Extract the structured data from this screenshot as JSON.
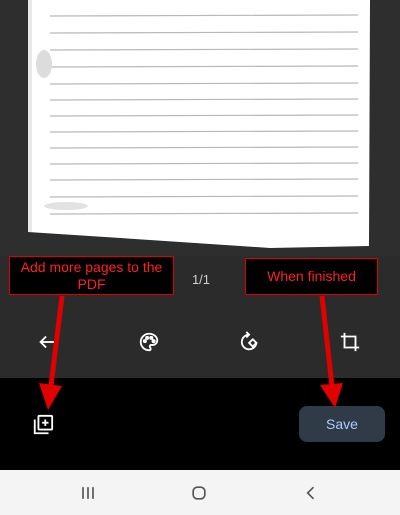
{
  "annotations": {
    "add_pages_note": "Add more pages to the PDF",
    "finished_note": "When finished"
  },
  "page_counter": "1/1",
  "edit_toolbar": {
    "icons": [
      "back-arrow-icon",
      "palette-icon",
      "rotate-icon",
      "crop-icon"
    ]
  },
  "action_bar": {
    "add_page_icon": "add-page-icon",
    "save_label": "Save"
  },
  "system_nav": {
    "icons": [
      "recent-apps-icon",
      "home-icon",
      "back-icon"
    ]
  },
  "colors": {
    "annotation_red": "#e00000",
    "save_button_bg": "#2f3b47",
    "save_button_text": "#aecbfa",
    "toolbar_bg": "#2b2b2b",
    "action_bar_bg": "#000000",
    "nav_bar_bg": "#f4f4f4"
  }
}
